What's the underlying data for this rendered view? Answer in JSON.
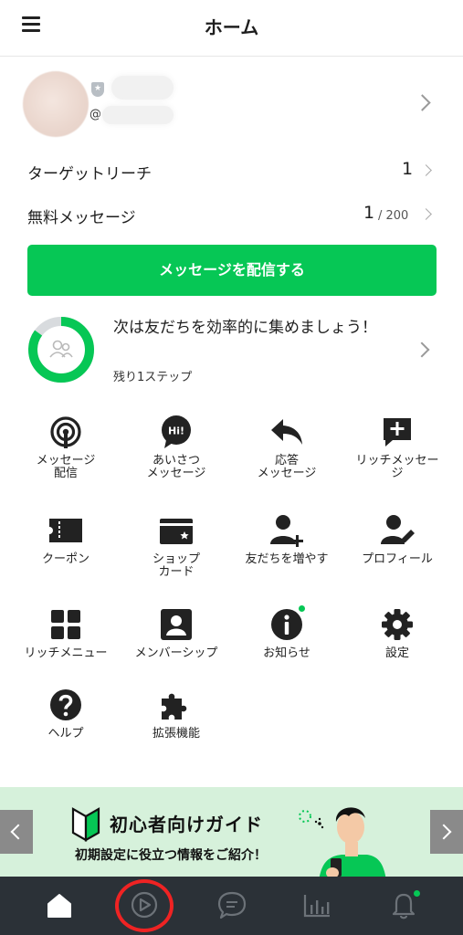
{
  "header": {
    "title": "ホーム"
  },
  "profile": {
    "at_prefix": "@"
  },
  "stats": {
    "target_reach": {
      "label": "ターゲットリーチ",
      "value": "1"
    },
    "free_messages": {
      "label": "無料メッセージ",
      "value": "1",
      "limit": "/ 200"
    }
  },
  "send_button": {
    "label": "メッセージを配信する"
  },
  "setup_progress": {
    "title": "次は友だちを効率的に集めましょう！",
    "subtitle": "残り1ステップ",
    "completed_fraction": 0.85
  },
  "menu_tiles": [
    {
      "label": "メッセージ\n配信",
      "icon": "antenna-icon"
    },
    {
      "label": "あいさつ\nメッセージ",
      "icon": "hi-bubble-icon",
      "badge": "Hi!"
    },
    {
      "label": "応答\nメッセージ",
      "icon": "reply-icon"
    },
    {
      "label": "リッチメッセー\nジ",
      "icon": "rich-message-icon"
    },
    {
      "label": "クーポン",
      "icon": "coupon-icon"
    },
    {
      "label": "ショップ\nカード",
      "icon": "shop-card-icon"
    },
    {
      "label": "友だちを増やす",
      "icon": "add-friend-icon"
    },
    {
      "label": "プロフィール",
      "icon": "profile-edit-icon"
    },
    {
      "label": "リッチメニュー",
      "icon": "rich-menu-icon"
    },
    {
      "label": "メンバーシップ",
      "icon": "membership-icon"
    },
    {
      "label": "お知らせ",
      "icon": "info-icon"
    },
    {
      "label": "設定",
      "icon": "gear-icon"
    },
    {
      "label": "ヘルプ",
      "icon": "help-icon"
    },
    {
      "label": "拡張機能",
      "icon": "puzzle-icon"
    }
  ],
  "banner": {
    "title": "初心者向けガイド",
    "subtitle": "初期設定に役立つ情報をご紹介！"
  },
  "tabbar": {
    "tabs": [
      "home-icon",
      "play-icon",
      "chat-icon",
      "analytics-icon",
      "bell-icon"
    ],
    "active": "home-icon",
    "colors": {
      "background": "#2b3137",
      "active": "#ffffff",
      "inactive": "#6c7278",
      "badge": "#06c755"
    }
  },
  "colors": {
    "accent": "#06c755",
    "highlight_ring": "#ef2323",
    "banner_bg": "#d6f1db"
  }
}
